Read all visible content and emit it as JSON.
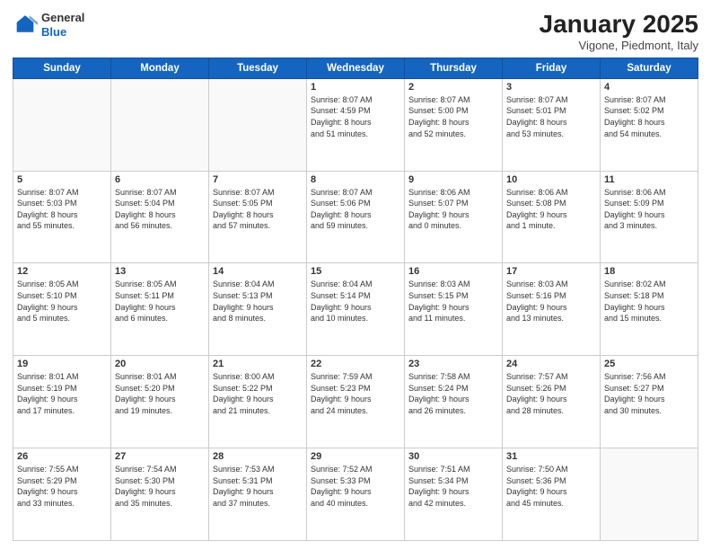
{
  "header": {
    "logo_general": "General",
    "logo_blue": "Blue",
    "title": "January 2025",
    "subtitle": "Vigone, Piedmont, Italy"
  },
  "weekdays": [
    "Sunday",
    "Monday",
    "Tuesday",
    "Wednesday",
    "Thursday",
    "Friday",
    "Saturday"
  ],
  "weeks": [
    [
      {
        "day": "",
        "info": ""
      },
      {
        "day": "",
        "info": ""
      },
      {
        "day": "",
        "info": ""
      },
      {
        "day": "1",
        "info": "Sunrise: 8:07 AM\nSunset: 4:59 PM\nDaylight: 8 hours\nand 51 minutes."
      },
      {
        "day": "2",
        "info": "Sunrise: 8:07 AM\nSunset: 5:00 PM\nDaylight: 8 hours\nand 52 minutes."
      },
      {
        "day": "3",
        "info": "Sunrise: 8:07 AM\nSunset: 5:01 PM\nDaylight: 8 hours\nand 53 minutes."
      },
      {
        "day": "4",
        "info": "Sunrise: 8:07 AM\nSunset: 5:02 PM\nDaylight: 8 hours\nand 54 minutes."
      }
    ],
    [
      {
        "day": "5",
        "info": "Sunrise: 8:07 AM\nSunset: 5:03 PM\nDaylight: 8 hours\nand 55 minutes."
      },
      {
        "day": "6",
        "info": "Sunrise: 8:07 AM\nSunset: 5:04 PM\nDaylight: 8 hours\nand 56 minutes."
      },
      {
        "day": "7",
        "info": "Sunrise: 8:07 AM\nSunset: 5:05 PM\nDaylight: 8 hours\nand 57 minutes."
      },
      {
        "day": "8",
        "info": "Sunrise: 8:07 AM\nSunset: 5:06 PM\nDaylight: 8 hours\nand 59 minutes."
      },
      {
        "day": "9",
        "info": "Sunrise: 8:06 AM\nSunset: 5:07 PM\nDaylight: 9 hours\nand 0 minutes."
      },
      {
        "day": "10",
        "info": "Sunrise: 8:06 AM\nSunset: 5:08 PM\nDaylight: 9 hours\nand 1 minute."
      },
      {
        "day": "11",
        "info": "Sunrise: 8:06 AM\nSunset: 5:09 PM\nDaylight: 9 hours\nand 3 minutes."
      }
    ],
    [
      {
        "day": "12",
        "info": "Sunrise: 8:05 AM\nSunset: 5:10 PM\nDaylight: 9 hours\nand 5 minutes."
      },
      {
        "day": "13",
        "info": "Sunrise: 8:05 AM\nSunset: 5:11 PM\nDaylight: 9 hours\nand 6 minutes."
      },
      {
        "day": "14",
        "info": "Sunrise: 8:04 AM\nSunset: 5:13 PM\nDaylight: 9 hours\nand 8 minutes."
      },
      {
        "day": "15",
        "info": "Sunrise: 8:04 AM\nSunset: 5:14 PM\nDaylight: 9 hours\nand 10 minutes."
      },
      {
        "day": "16",
        "info": "Sunrise: 8:03 AM\nSunset: 5:15 PM\nDaylight: 9 hours\nand 11 minutes."
      },
      {
        "day": "17",
        "info": "Sunrise: 8:03 AM\nSunset: 5:16 PM\nDaylight: 9 hours\nand 13 minutes."
      },
      {
        "day": "18",
        "info": "Sunrise: 8:02 AM\nSunset: 5:18 PM\nDaylight: 9 hours\nand 15 minutes."
      }
    ],
    [
      {
        "day": "19",
        "info": "Sunrise: 8:01 AM\nSunset: 5:19 PM\nDaylight: 9 hours\nand 17 minutes."
      },
      {
        "day": "20",
        "info": "Sunrise: 8:01 AM\nSunset: 5:20 PM\nDaylight: 9 hours\nand 19 minutes."
      },
      {
        "day": "21",
        "info": "Sunrise: 8:00 AM\nSunset: 5:22 PM\nDaylight: 9 hours\nand 21 minutes."
      },
      {
        "day": "22",
        "info": "Sunrise: 7:59 AM\nSunset: 5:23 PM\nDaylight: 9 hours\nand 24 minutes."
      },
      {
        "day": "23",
        "info": "Sunrise: 7:58 AM\nSunset: 5:24 PM\nDaylight: 9 hours\nand 26 minutes."
      },
      {
        "day": "24",
        "info": "Sunrise: 7:57 AM\nSunset: 5:26 PM\nDaylight: 9 hours\nand 28 minutes."
      },
      {
        "day": "25",
        "info": "Sunrise: 7:56 AM\nSunset: 5:27 PM\nDaylight: 9 hours\nand 30 minutes."
      }
    ],
    [
      {
        "day": "26",
        "info": "Sunrise: 7:55 AM\nSunset: 5:29 PM\nDaylight: 9 hours\nand 33 minutes."
      },
      {
        "day": "27",
        "info": "Sunrise: 7:54 AM\nSunset: 5:30 PM\nDaylight: 9 hours\nand 35 minutes."
      },
      {
        "day": "28",
        "info": "Sunrise: 7:53 AM\nSunset: 5:31 PM\nDaylight: 9 hours\nand 37 minutes."
      },
      {
        "day": "29",
        "info": "Sunrise: 7:52 AM\nSunset: 5:33 PM\nDaylight: 9 hours\nand 40 minutes."
      },
      {
        "day": "30",
        "info": "Sunrise: 7:51 AM\nSunset: 5:34 PM\nDaylight: 9 hours\nand 42 minutes."
      },
      {
        "day": "31",
        "info": "Sunrise: 7:50 AM\nSunset: 5:36 PM\nDaylight: 9 hours\nand 45 minutes."
      },
      {
        "day": "",
        "info": ""
      }
    ]
  ]
}
